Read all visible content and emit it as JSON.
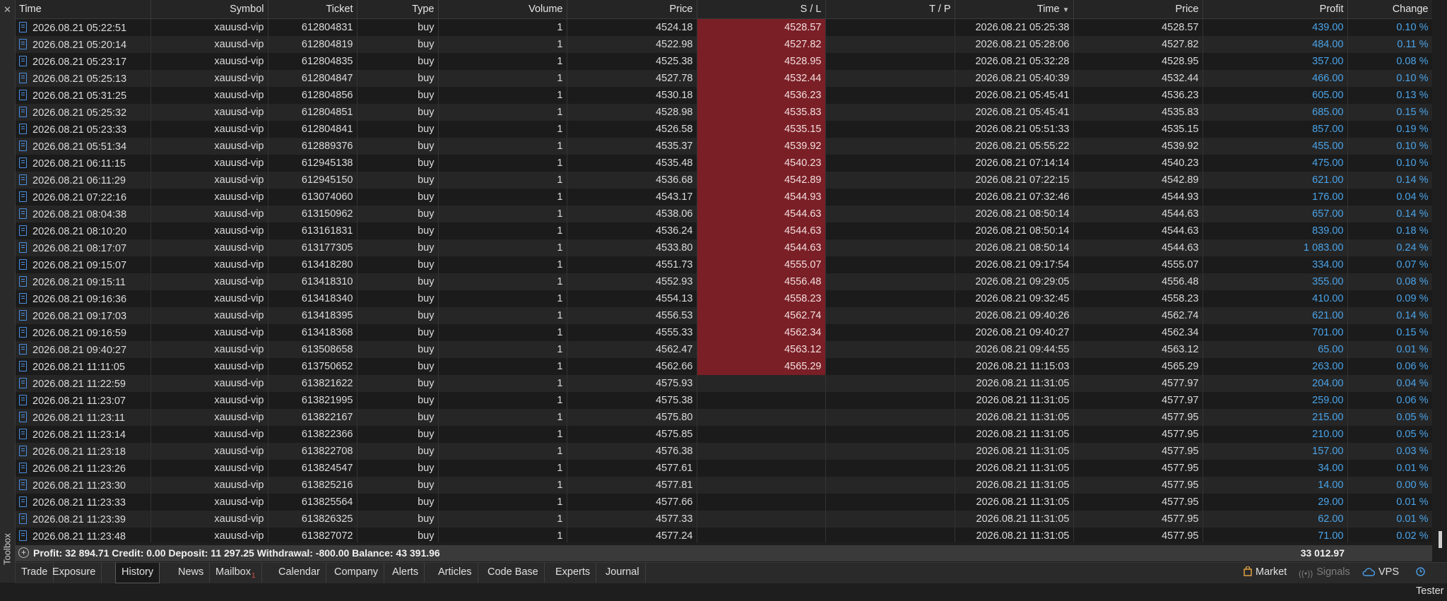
{
  "toolbox_label": "Toolbox",
  "columns": [
    "Time",
    "Symbol",
    "Ticket",
    "Type",
    "Volume",
    "Price",
    "S / L",
    "T / P",
    "Time",
    "Price",
    "Profit",
    "Change"
  ],
  "sorted_column_arrow": "▼",
  "rows": [
    {
      "time": "2026.08.21 05:22:51",
      "symbol": "xauusd-vip",
      "ticket": "612804831",
      "type": "buy",
      "volume": "1",
      "price": "4524.18",
      "sl": "4528.57",
      "tp": "",
      "close_time": "2026.08.21 05:25:38",
      "close_price": "4528.57",
      "profit": "439.00",
      "change": "0.10 %",
      "sl_hit": true
    },
    {
      "time": "2026.08.21 05:20:14",
      "symbol": "xauusd-vip",
      "ticket": "612804819",
      "type": "buy",
      "volume": "1",
      "price": "4522.98",
      "sl": "4527.82",
      "tp": "",
      "close_time": "2026.08.21 05:28:06",
      "close_price": "4527.82",
      "profit": "484.00",
      "change": "0.11 %",
      "sl_hit": true
    },
    {
      "time": "2026.08.21 05:23:17",
      "symbol": "xauusd-vip",
      "ticket": "612804835",
      "type": "buy",
      "volume": "1",
      "price": "4525.38",
      "sl": "4528.95",
      "tp": "",
      "close_time": "2026.08.21 05:32:28",
      "close_price": "4528.95",
      "profit": "357.00",
      "change": "0.08 %",
      "sl_hit": true
    },
    {
      "time": "2026.08.21 05:25:13",
      "symbol": "xauusd-vip",
      "ticket": "612804847",
      "type": "buy",
      "volume": "1",
      "price": "4527.78",
      "sl": "4532.44",
      "tp": "",
      "close_time": "2026.08.21 05:40:39",
      "close_price": "4532.44",
      "profit": "466.00",
      "change": "0.10 %",
      "sl_hit": true
    },
    {
      "time": "2026.08.21 05:31:25",
      "symbol": "xauusd-vip",
      "ticket": "612804856",
      "type": "buy",
      "volume": "1",
      "price": "4530.18",
      "sl": "4536.23",
      "tp": "",
      "close_time": "2026.08.21 05:45:41",
      "close_price": "4536.23",
      "profit": "605.00",
      "change": "0.13 %",
      "sl_hit": true
    },
    {
      "time": "2026.08.21 05:25:32",
      "symbol": "xauusd-vip",
      "ticket": "612804851",
      "type": "buy",
      "volume": "1",
      "price": "4528.98",
      "sl": "4535.83",
      "tp": "",
      "close_time": "2026.08.21 05:45:41",
      "close_price": "4535.83",
      "profit": "685.00",
      "change": "0.15 %",
      "sl_hit": true
    },
    {
      "time": "2026.08.21 05:23:33",
      "symbol": "xauusd-vip",
      "ticket": "612804841",
      "type": "buy",
      "volume": "1",
      "price": "4526.58",
      "sl": "4535.15",
      "tp": "",
      "close_time": "2026.08.21 05:51:33",
      "close_price": "4535.15",
      "profit": "857.00",
      "change": "0.19 %",
      "sl_hit": true
    },
    {
      "time": "2026.08.21 05:51:34",
      "symbol": "xauusd-vip",
      "ticket": "612889376",
      "type": "buy",
      "volume": "1",
      "price": "4535.37",
      "sl": "4539.92",
      "tp": "",
      "close_time": "2026.08.21 05:55:22",
      "close_price": "4539.92",
      "profit": "455.00",
      "change": "0.10 %",
      "sl_hit": true
    },
    {
      "time": "2026.08.21 06:11:15",
      "symbol": "xauusd-vip",
      "ticket": "612945138",
      "type": "buy",
      "volume": "1",
      "price": "4535.48",
      "sl": "4540.23",
      "tp": "",
      "close_time": "2026.08.21 07:14:14",
      "close_price": "4540.23",
      "profit": "475.00",
      "change": "0.10 %",
      "sl_hit": true
    },
    {
      "time": "2026.08.21 06:11:29",
      "symbol": "xauusd-vip",
      "ticket": "612945150",
      "type": "buy",
      "volume": "1",
      "price": "4536.68",
      "sl": "4542.89",
      "tp": "",
      "close_time": "2026.08.21 07:22:15",
      "close_price": "4542.89",
      "profit": "621.00",
      "change": "0.14 %",
      "sl_hit": true
    },
    {
      "time": "2026.08.21 07:22:16",
      "symbol": "xauusd-vip",
      "ticket": "613074060",
      "type": "buy",
      "volume": "1",
      "price": "4543.17",
      "sl": "4544.93",
      "tp": "",
      "close_time": "2026.08.21 07:32:46",
      "close_price": "4544.93",
      "profit": "176.00",
      "change": "0.04 %",
      "sl_hit": true
    },
    {
      "time": "2026.08.21 08:04:38",
      "symbol": "xauusd-vip",
      "ticket": "613150962",
      "type": "buy",
      "volume": "1",
      "price": "4538.06",
      "sl": "4544.63",
      "tp": "",
      "close_time": "2026.08.21 08:50:14",
      "close_price": "4544.63",
      "profit": "657.00",
      "change": "0.14 %",
      "sl_hit": true
    },
    {
      "time": "2026.08.21 08:10:20",
      "symbol": "xauusd-vip",
      "ticket": "613161831",
      "type": "buy",
      "volume": "1",
      "price": "4536.24",
      "sl": "4544.63",
      "tp": "",
      "close_time": "2026.08.21 08:50:14",
      "close_price": "4544.63",
      "profit": "839.00",
      "change": "0.18 %",
      "sl_hit": true
    },
    {
      "time": "2026.08.21 08:17:07",
      "symbol": "xauusd-vip",
      "ticket": "613177305",
      "type": "buy",
      "volume": "1",
      "price": "4533.80",
      "sl": "4544.63",
      "tp": "",
      "close_time": "2026.08.21 08:50:14",
      "close_price": "4544.63",
      "profit": "1 083.00",
      "change": "0.24 %",
      "sl_hit": true
    },
    {
      "time": "2026.08.21 09:15:07",
      "symbol": "xauusd-vip",
      "ticket": "613418280",
      "type": "buy",
      "volume": "1",
      "price": "4551.73",
      "sl": "4555.07",
      "tp": "",
      "close_time": "2026.08.21 09:17:54",
      "close_price": "4555.07",
      "profit": "334.00",
      "change": "0.07 %",
      "sl_hit": true
    },
    {
      "time": "2026.08.21 09:15:11",
      "symbol": "xauusd-vip",
      "ticket": "613418310",
      "type": "buy",
      "volume": "1",
      "price": "4552.93",
      "sl": "4556.48",
      "tp": "",
      "close_time": "2026.08.21 09:29:05",
      "close_price": "4556.48",
      "profit": "355.00",
      "change": "0.08 %",
      "sl_hit": true
    },
    {
      "time": "2026.08.21 09:16:36",
      "symbol": "xauusd-vip",
      "ticket": "613418340",
      "type": "buy",
      "volume": "1",
      "price": "4554.13",
      "sl": "4558.23",
      "tp": "",
      "close_time": "2026.08.21 09:32:45",
      "close_price": "4558.23",
      "profit": "410.00",
      "change": "0.09 %",
      "sl_hit": true
    },
    {
      "time": "2026.08.21 09:17:03",
      "symbol": "xauusd-vip",
      "ticket": "613418395",
      "type": "buy",
      "volume": "1",
      "price": "4556.53",
      "sl": "4562.74",
      "tp": "",
      "close_time": "2026.08.21 09:40:26",
      "close_price": "4562.74",
      "profit": "621.00",
      "change": "0.14 %",
      "sl_hit": true
    },
    {
      "time": "2026.08.21 09:16:59",
      "symbol": "xauusd-vip",
      "ticket": "613418368",
      "type": "buy",
      "volume": "1",
      "price": "4555.33",
      "sl": "4562.34",
      "tp": "",
      "close_time": "2026.08.21 09:40:27",
      "close_price": "4562.34",
      "profit": "701.00",
      "change": "0.15 %",
      "sl_hit": true
    },
    {
      "time": "2026.08.21 09:40:27",
      "symbol": "xauusd-vip",
      "ticket": "613508658",
      "type": "buy",
      "volume": "1",
      "price": "4562.47",
      "sl": "4563.12",
      "tp": "",
      "close_time": "2026.08.21 09:44:55",
      "close_price": "4563.12",
      "profit": "65.00",
      "change": "0.01 %",
      "sl_hit": true
    },
    {
      "time": "2026.08.21 11:11:05",
      "symbol": "xauusd-vip",
      "ticket": "613750652",
      "type": "buy",
      "volume": "1",
      "price": "4562.66",
      "sl": "4565.29",
      "tp": "",
      "close_time": "2026.08.21 11:15:03",
      "close_price": "4565.29",
      "profit": "263.00",
      "change": "0.06 %",
      "sl_hit": true
    },
    {
      "time": "2026.08.21 11:22:59",
      "symbol": "xauusd-vip",
      "ticket": "613821622",
      "type": "buy",
      "volume": "1",
      "price": "4575.93",
      "sl": "",
      "tp": "",
      "close_time": "2026.08.21 11:31:05",
      "close_price": "4577.97",
      "profit": "204.00",
      "change": "0.04 %",
      "sl_hit": false
    },
    {
      "time": "2026.08.21 11:23:07",
      "symbol": "xauusd-vip",
      "ticket": "613821995",
      "type": "buy",
      "volume": "1",
      "price": "4575.38",
      "sl": "",
      "tp": "",
      "close_time": "2026.08.21 11:31:05",
      "close_price": "4577.97",
      "profit": "259.00",
      "change": "0.06 %",
      "sl_hit": false
    },
    {
      "time": "2026.08.21 11:23:11",
      "symbol": "xauusd-vip",
      "ticket": "613822167",
      "type": "buy",
      "volume": "1",
      "price": "4575.80",
      "sl": "",
      "tp": "",
      "close_time": "2026.08.21 11:31:05",
      "close_price": "4577.95",
      "profit": "215.00",
      "change": "0.05 %",
      "sl_hit": false
    },
    {
      "time": "2026.08.21 11:23:14",
      "symbol": "xauusd-vip",
      "ticket": "613822366",
      "type": "buy",
      "volume": "1",
      "price": "4575.85",
      "sl": "",
      "tp": "",
      "close_time": "2026.08.21 11:31:05",
      "close_price": "4577.95",
      "profit": "210.00",
      "change": "0.05 %",
      "sl_hit": false
    },
    {
      "time": "2026.08.21 11:23:18",
      "symbol": "xauusd-vip",
      "ticket": "613822708",
      "type": "buy",
      "volume": "1",
      "price": "4576.38",
      "sl": "",
      "tp": "",
      "close_time": "2026.08.21 11:31:05",
      "close_price": "4577.95",
      "profit": "157.00",
      "change": "0.03 %",
      "sl_hit": false
    },
    {
      "time": "2026.08.21 11:23:26",
      "symbol": "xauusd-vip",
      "ticket": "613824547",
      "type": "buy",
      "volume": "1",
      "price": "4577.61",
      "sl": "",
      "tp": "",
      "close_time": "2026.08.21 11:31:05",
      "close_price": "4577.95",
      "profit": "34.00",
      "change": "0.01 %",
      "sl_hit": false
    },
    {
      "time": "2026.08.21 11:23:30",
      "symbol": "xauusd-vip",
      "ticket": "613825216",
      "type": "buy",
      "volume": "1",
      "price": "4577.81",
      "sl": "",
      "tp": "",
      "close_time": "2026.08.21 11:31:05",
      "close_price": "4577.95",
      "profit": "14.00",
      "change": "0.00 %",
      "sl_hit": false
    },
    {
      "time": "2026.08.21 11:23:33",
      "symbol": "xauusd-vip",
      "ticket": "613825564",
      "type": "buy",
      "volume": "1",
      "price": "4577.66",
      "sl": "",
      "tp": "",
      "close_time": "2026.08.21 11:31:05",
      "close_price": "4577.95",
      "profit": "29.00",
      "change": "0.01 %",
      "sl_hit": false
    },
    {
      "time": "2026.08.21 11:23:39",
      "symbol": "xauusd-vip",
      "ticket": "613826325",
      "type": "buy",
      "volume": "1",
      "price": "4577.33",
      "sl": "",
      "tp": "",
      "close_time": "2026.08.21 11:31:05",
      "close_price": "4577.95",
      "profit": "62.00",
      "change": "0.01 %",
      "sl_hit": false
    },
    {
      "time": "2026.08.21 11:23:48",
      "symbol": "xauusd-vip",
      "ticket": "613827072",
      "type": "buy",
      "volume": "1",
      "price": "4577.24",
      "sl": "",
      "tp": "",
      "close_time": "2026.08.21 11:31:05",
      "close_price": "4577.95",
      "profit": "71.00",
      "change": "0.02 %",
      "sl_hit": false
    }
  ],
  "summary": {
    "text": "Profit: 32 894.71  Credit: 0.00  Deposit: 11 297.25  Withdrawal: -800.00  Balance: 43 391.96",
    "total_profit": "33 012.97"
  },
  "tabs": [
    {
      "label": "Trade",
      "active": false
    },
    {
      "label": "Exposure",
      "active": false
    },
    {
      "label": "History",
      "active": true
    },
    {
      "label": "News",
      "active": false
    },
    {
      "label": "Mailbox",
      "badge": "1",
      "active": false
    },
    {
      "label": "Calendar",
      "active": false
    },
    {
      "label": "Company",
      "active": false
    },
    {
      "label": "Alerts",
      "active": false
    },
    {
      "label": "Articles",
      "active": false
    },
    {
      "label": "Code Base",
      "active": false
    },
    {
      "label": "Experts",
      "active": false
    },
    {
      "label": "Journal",
      "active": false
    }
  ],
  "right_tabs": {
    "market": "Market",
    "signals": "Signals",
    "vps": "VPS",
    "tester": "Tester"
  },
  "colors": {
    "sl_hit_bg": "#7a1f26",
    "profit_text": "#4aa3e8",
    "icon_blue": "#4a8fe0",
    "mailbox_badge": "#e34b4b"
  }
}
